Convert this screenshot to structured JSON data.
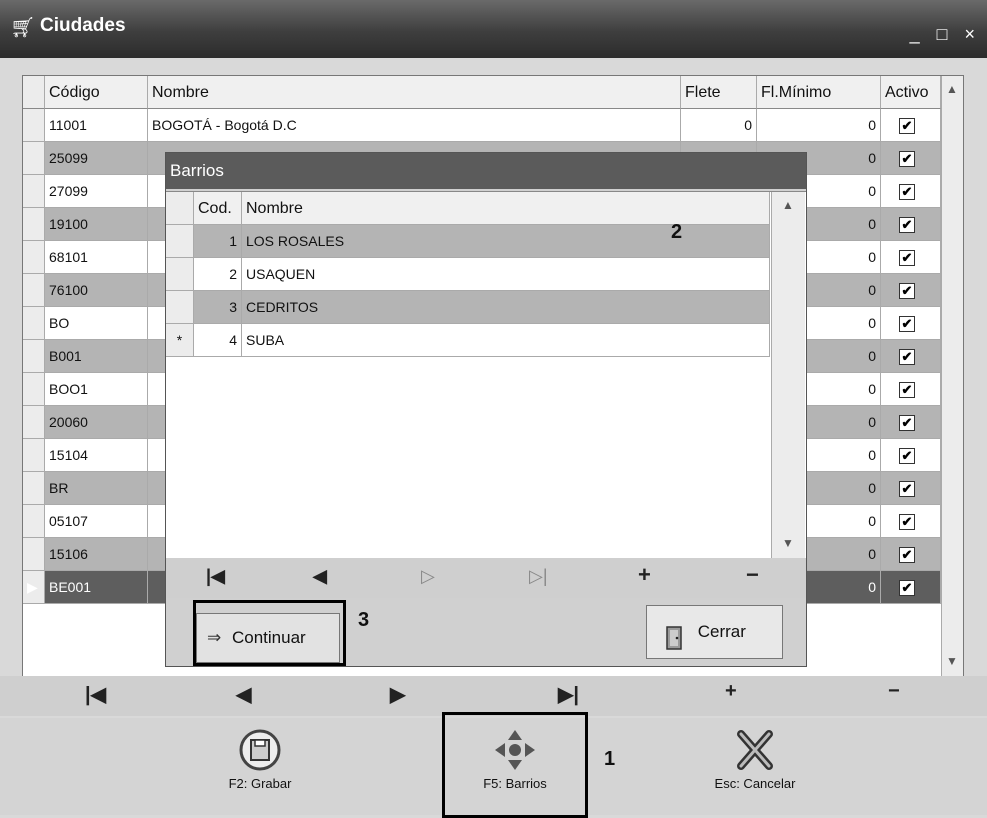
{
  "window": {
    "title": "Ciudades",
    "title_icon": "cart-icon",
    "controls": "_ □ ×"
  },
  "grid": {
    "headers": [
      "Código",
      "Nombre",
      "Flete",
      "Fl.Mínimo",
      "Activo"
    ],
    "rows": [
      {
        "code": "11001",
        "name": "BOGOTÁ - Bogotá D.C",
        "flete": "0",
        "fmin": "0",
        "active": "✔"
      },
      {
        "code": "25099",
        "name": "",
        "flete": "",
        "fmin": "0",
        "active": "✔"
      },
      {
        "code": "27099",
        "name": "",
        "flete": "",
        "fmin": "0",
        "active": "✔"
      },
      {
        "code": "19100",
        "name": "",
        "flete": "",
        "fmin": "0",
        "active": "✔"
      },
      {
        "code": "68101",
        "name": "",
        "flete": "",
        "fmin": "0",
        "active": "✔"
      },
      {
        "code": "76100",
        "name": "",
        "flete": "",
        "fmin": "0",
        "active": "✔"
      },
      {
        "code": "BO",
        "name": "",
        "flete": "",
        "fmin": "0",
        "active": "✔"
      },
      {
        "code": "B001",
        "name": "",
        "flete": "",
        "fmin": "0",
        "active": "✔"
      },
      {
        "code": "BOO1",
        "name": "",
        "flete": "",
        "fmin": "0",
        "active": "✔"
      },
      {
        "code": "20060",
        "name": "",
        "flete": "",
        "fmin": "0",
        "active": "✔"
      },
      {
        "code": "15104",
        "name": "",
        "flete": "",
        "fmin": "0",
        "active": "✔"
      },
      {
        "code": "BR",
        "name": "",
        "flete": "",
        "fmin": "0",
        "active": "✔"
      },
      {
        "code": "05107",
        "name": "",
        "flete": "",
        "fmin": "0",
        "active": "✔"
      },
      {
        "code": "15106",
        "name": "",
        "flete": "",
        "fmin": "0",
        "active": "✔"
      },
      {
        "code": "BE001",
        "name": "",
        "flete": "",
        "fmin": "0",
        "active": "✔"
      }
    ],
    "current_row_marker": "▶"
  },
  "main_nav": [
    "|◀",
    "◀",
    "▶",
    "▶|",
    "+",
    "−"
  ],
  "toolbar": {
    "save_label": "F2: Grabar",
    "barrios_label": "F5: Barrios",
    "cancel_label": "Esc: Cancelar",
    "callout_1": "1"
  },
  "dialog": {
    "title": "Barrios",
    "headers": [
      "Cod.",
      "Nombre"
    ],
    "rows": [
      {
        "indicator": "",
        "cod": "1",
        "name": "LOS ROSALES"
      },
      {
        "indicator": "",
        "cod": "2",
        "name": "USAQUEN"
      },
      {
        "indicator": "",
        "cod": "3",
        "name": "CEDRITOS"
      },
      {
        "indicator": "*",
        "cod": "4",
        "name": "SUBA"
      }
    ],
    "nav": [
      "|◀",
      "◀",
      "▷",
      "▷|",
      "+",
      "−"
    ],
    "callout_2": "2",
    "callout_3": "3",
    "continuar_label": "Continuar",
    "continuar_icon": "⇒",
    "cerrar_label": "Cerrar",
    "cerrar_icon": "door-exit-icon"
  }
}
